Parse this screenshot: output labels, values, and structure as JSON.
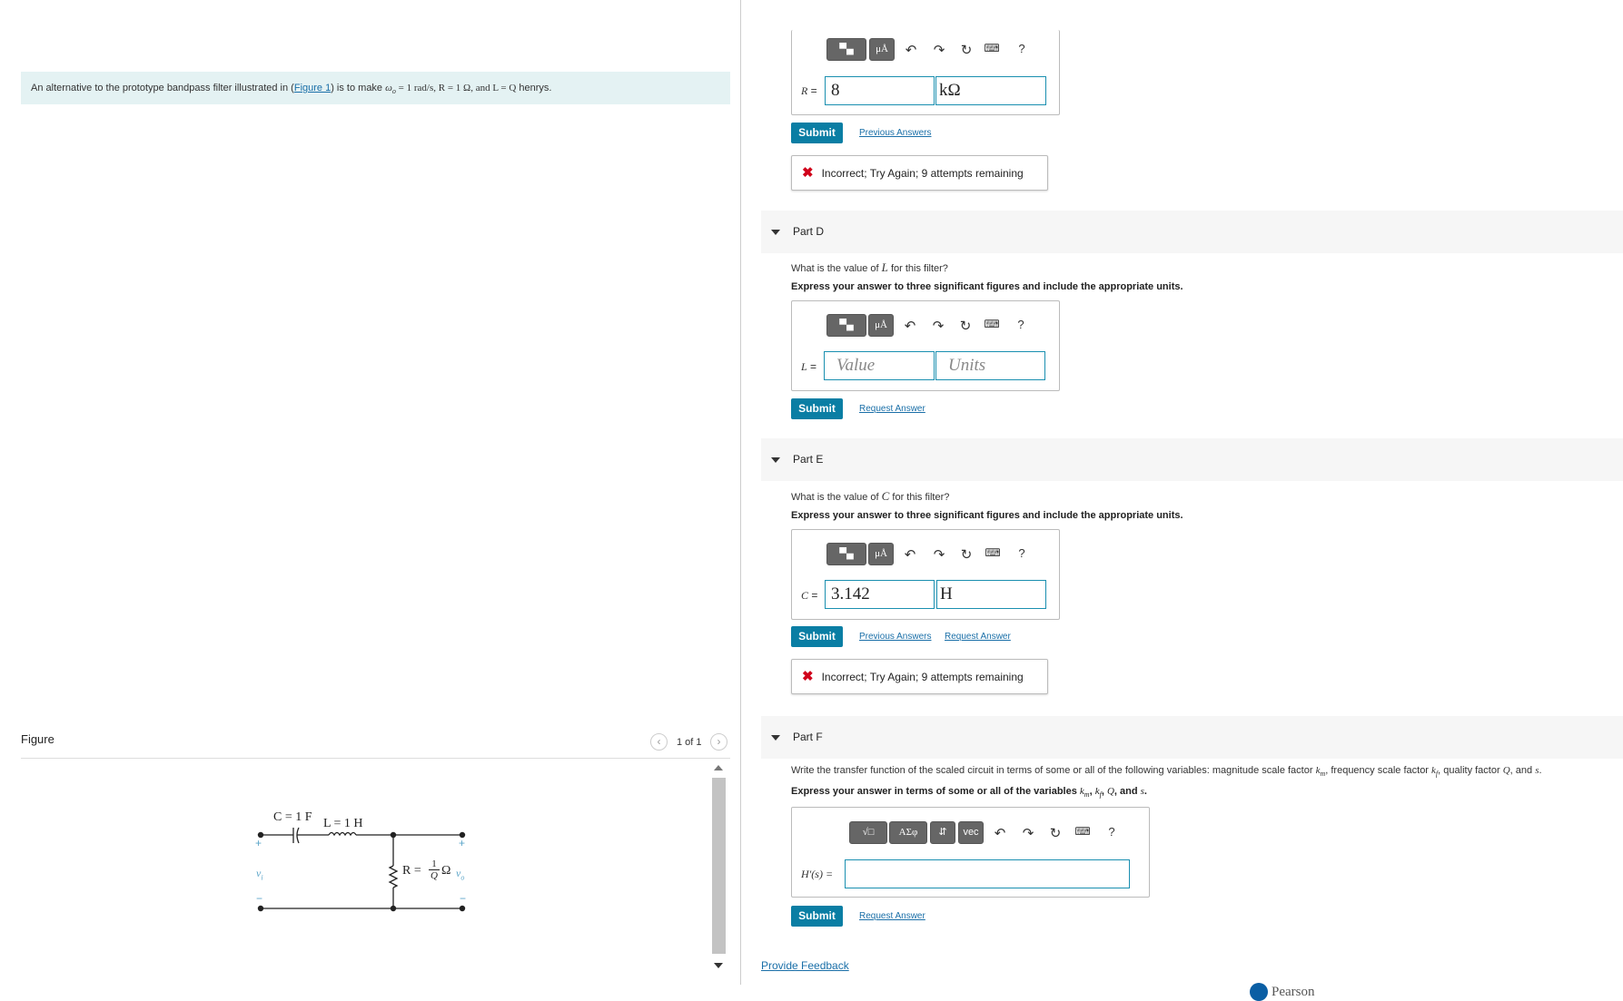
{
  "problem": {
    "text_before": "An alternative to the prototype bandpass filter illustrated in (",
    "figure_link": "Figure 1",
    "text_after": ") is to make ",
    "omega_sym": "ω",
    "omega_sub": "o",
    "omega_val": " = 1 rad/s",
    "r_part": ", R = 1 Ω",
    "l_part": ", and L = Q",
    "end": " henrys."
  },
  "figure": {
    "title": "Figure",
    "pager": "1 of 1",
    "prev_icon": "chevron-left-icon",
    "next_icon": "chevron-right-icon",
    "circuit": {
      "c_label": "C = 1 F",
      "l_label": "L = 1 H",
      "r_label": "R = ",
      "r_frac_num": "1",
      "r_frac_den": "Q",
      "r_unit": "Ω",
      "vi": "v",
      "vi_sub": "i",
      "vo": "v",
      "vo_sub": "o",
      "plus": "+",
      "minus": "−"
    }
  },
  "toolbar": {
    "templates_icon": "templates-icon",
    "units_label": "μÅ",
    "undo_icon": "undo-icon",
    "redo_icon": "redo-icon",
    "reset_icon": "reset-icon",
    "keyboard_icon": "keyboard-icon",
    "help_label": "?",
    "sqrt_label": "√□",
    "greek_label": "ΑΣφ",
    "arrows_label": "⇵",
    "vec_label": "vec"
  },
  "part_c": {
    "var": "R",
    "value": "8",
    "units": "kΩ",
    "submit": "Submit",
    "previous": "Previous Answers",
    "feedback": "Incorrect; Try Again; 9 attempts remaining"
  },
  "part_d": {
    "title": "Part D",
    "question_pre": "What is the value of ",
    "question_var": "L",
    "question_post": " for this filter?",
    "instruction": "Express your answer to three significant figures and include the appropriate units.",
    "var": "L",
    "value_placeholder": "Value",
    "units_placeholder": "Units",
    "submit": "Submit",
    "request": "Request Answer"
  },
  "part_e": {
    "title": "Part E",
    "question_pre": "What is the value of ",
    "question_var": "C",
    "question_post": " for this filter?",
    "instruction": "Express your answer to three significant figures and include the appropriate units.",
    "var": "C",
    "value": "3.142",
    "units": "H",
    "submit": "Submit",
    "previous": "Previous Answers",
    "request": "Request Answer",
    "feedback": "Incorrect; Try Again; 9 attempts remaining"
  },
  "part_f": {
    "title": "Part F",
    "question_a": "Write the transfer function of the scaled circuit in terms of some or all of the following variables: magnitude scale factor ",
    "km": "k",
    "km_sub": "m",
    "question_b": ", frequency scale factor ",
    "kf": "k",
    "kf_sub": "f",
    "question_c": ", quality factor ",
    "q": "Q",
    "question_d": ", and ",
    "s": "s",
    "question_e": ".",
    "instruction_a": "Express your answer in terms of some or all of the variables ",
    "instruction_b": ", ",
    "instruction_c": ", and ",
    "instruction_d": ".",
    "var": "H′(s) = ",
    "submit": "Submit",
    "request": "Request Answer"
  },
  "footer": {
    "feedback_link": "Provide Feedback",
    "brand": "Pearson"
  }
}
